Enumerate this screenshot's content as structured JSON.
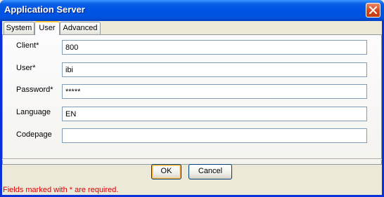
{
  "window": {
    "title": "Application Server"
  },
  "tabs": [
    {
      "label": "System",
      "active": false
    },
    {
      "label": "User",
      "active": true
    },
    {
      "label": "Advanced",
      "active": false
    }
  ],
  "fields": {
    "client": {
      "label": "Client*",
      "value": "800"
    },
    "user": {
      "label": "User*",
      "value": "ibi"
    },
    "password": {
      "label": "Password*",
      "value": "*****"
    },
    "language": {
      "label": "Language",
      "value": "EN"
    },
    "codepage": {
      "label": "Codepage",
      "value": ""
    }
  },
  "buttons": {
    "ok": "OK",
    "cancel": "Cancel"
  },
  "footer": {
    "note": "Fields marked with * are required."
  },
  "colors": {
    "titlebar": "#0054e3",
    "required_note": "#e00000",
    "dialog_bg": "#ece9d8"
  },
  "icons": {
    "close": "close-icon"
  }
}
